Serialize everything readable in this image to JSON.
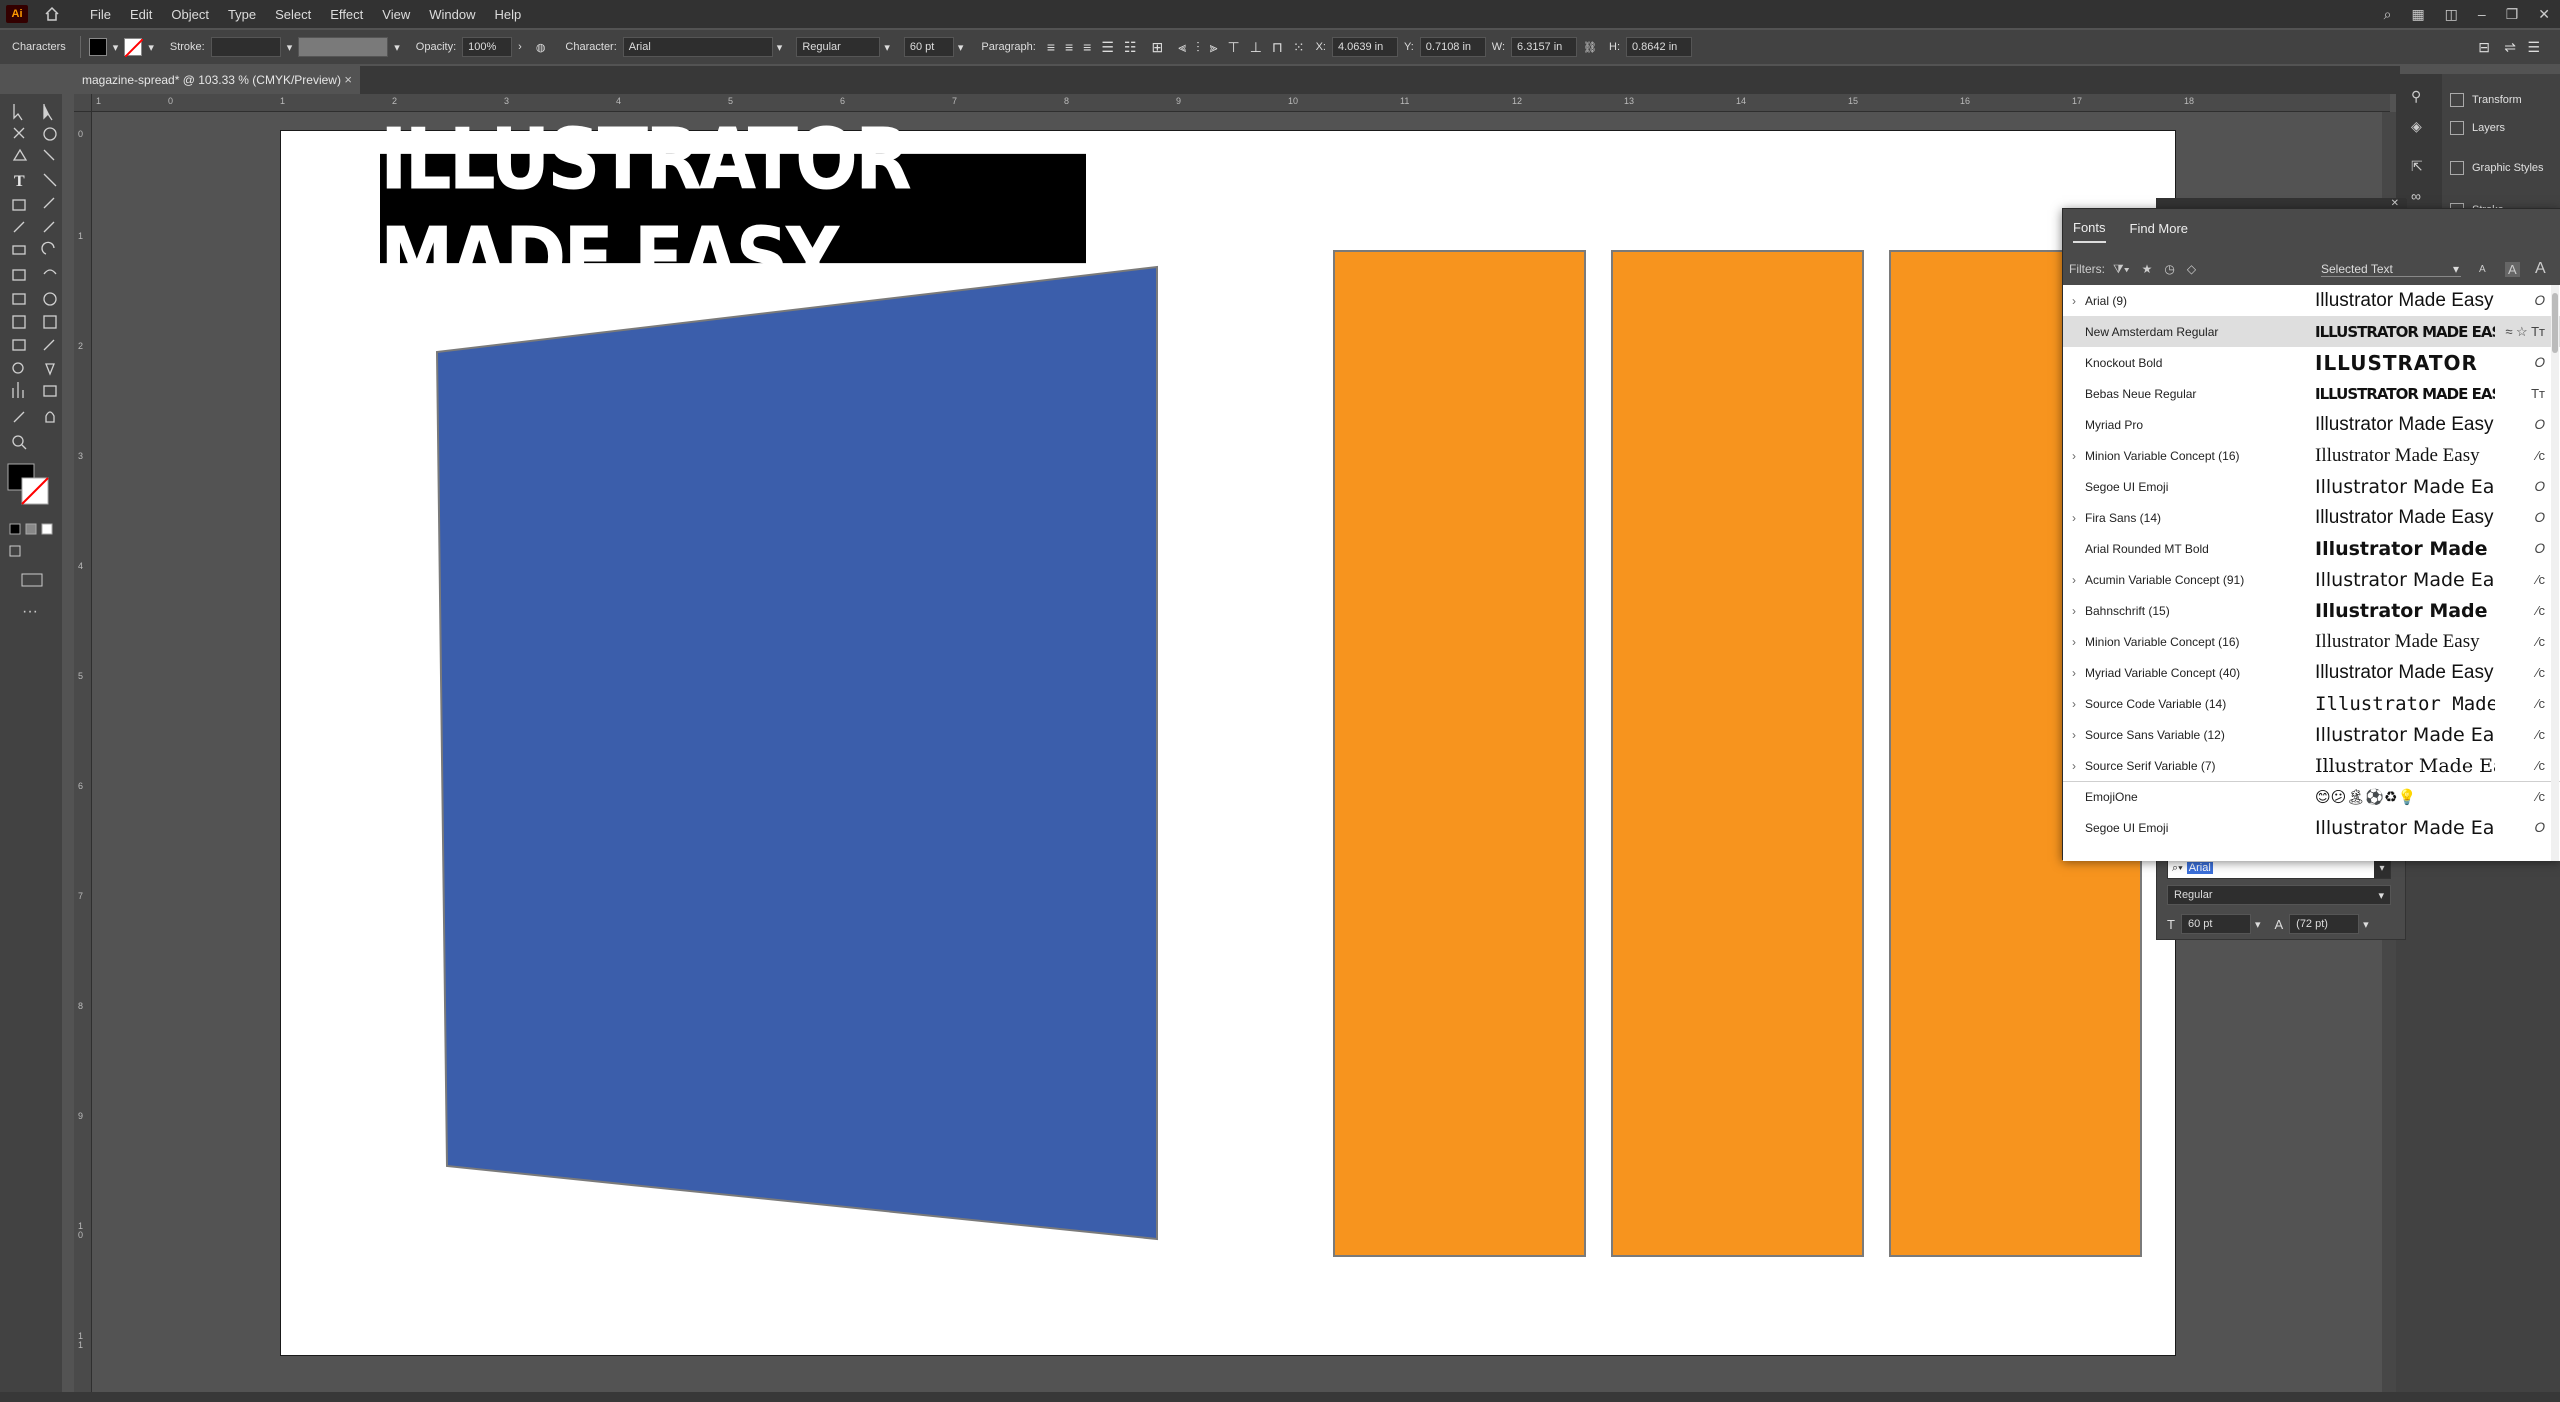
{
  "menubar": {
    "app_logo": "Ai",
    "items": [
      "File",
      "Edit",
      "Object",
      "Type",
      "Select",
      "Effect",
      "View",
      "Window",
      "Help"
    ]
  },
  "control": {
    "panel_name": "Characters",
    "stroke_label": "Stroke:",
    "opacity_label": "Opacity:",
    "opacity_value": "100%",
    "character_label": "Character:",
    "font_value": "Arial",
    "style_value": "Regular",
    "size_value": "60 pt",
    "paragraph_label": "Paragraph:",
    "x_label": "X:",
    "x_value": "4.0639 in",
    "y_label": "Y:",
    "y_value": "0.7108 in",
    "w_label": "W:",
    "w_value": "6.3157 in",
    "h_label": "H:",
    "h_value": "0.8642 in"
  },
  "document": {
    "tab_title": "magazine-spread* @ 103.33 % (CMYK/Preview)",
    "close": "×"
  },
  "ruler": {
    "h_ticks": [
      "1",
      "0",
      "1",
      "2",
      "3",
      "4",
      "5",
      "6",
      "7",
      "8",
      "9",
      "10",
      "11",
      "12",
      "13",
      "14",
      "15",
      "16",
      "17",
      "18"
    ],
    "v_ticks": [
      "0",
      "1",
      "2",
      "3",
      "4",
      "5",
      "6",
      "7",
      "8",
      "9",
      "1\n0",
      "1\n1"
    ]
  },
  "artboard": {
    "headline": "ILLUSTRATOR MADE EASY"
  },
  "colors": {
    "blue_shape": "#3b5eab",
    "orange_shape": "#f7941e"
  },
  "panels": {
    "transform": "Transform",
    "layers": "Layers",
    "graphic_styles": "Graphic Styles",
    "stroke": "Stroke"
  },
  "font_panel": {
    "tab_fonts": "Fonts",
    "tab_find_more": "Find More",
    "filters_label": "Filters:",
    "selected_text": "Selected Text",
    "fonts": [
      {
        "name": "Arial (9)",
        "preview": "Illustrator Made Easy",
        "has_children": true,
        "selected": false
      },
      {
        "name": "New Amsterdam Regular",
        "preview": "ILLUSTRATOR MADE EASY",
        "has_children": false,
        "selected": true
      },
      {
        "name": "Knockout Bold",
        "preview": "ILLUSTRATOR",
        "has_children": false,
        "selected": false
      },
      {
        "name": "Bebas Neue Regular",
        "preview": "ILLUSTRATOR MADE EASY",
        "has_children": false,
        "selected": false
      },
      {
        "name": "Myriad Pro",
        "preview": "Illustrator Made Easy",
        "has_children": false,
        "selected": false
      },
      {
        "name": "Minion Variable Concept (16)",
        "preview": "Illustrator Made Easy",
        "has_children": true,
        "selected": false
      },
      {
        "name": "Segoe UI Emoji",
        "preview": "Illustrator Made Easy",
        "has_children": false,
        "selected": false
      },
      {
        "name": "Fira Sans (14)",
        "preview": "Illustrator Made Easy",
        "has_children": true,
        "selected": false
      },
      {
        "name": "Arial Rounded MT Bold",
        "preview": "Illustrator Made Easy",
        "has_children": false,
        "selected": false
      },
      {
        "name": "Acumin Variable Concept (91)",
        "preview": "Illustrator Made Easy",
        "has_children": true,
        "selected": false
      },
      {
        "name": "Bahnschrift (15)",
        "preview": "Illustrator Made Easy",
        "has_children": true,
        "selected": false
      },
      {
        "name": "Minion Variable Concept (16)",
        "preview": "Illustrator Made Easy",
        "has_children": true,
        "selected": false
      },
      {
        "name": "Myriad Variable Concept (40)",
        "preview": "Illustrator Made Easy",
        "has_children": true,
        "selected": false
      },
      {
        "name": "Source Code Variable (14)",
        "preview": "Illustrator Made",
        "has_children": true,
        "selected": false
      },
      {
        "name": "Source Sans Variable (12)",
        "preview": "Illustrator Made Easy",
        "has_children": true,
        "selected": false
      },
      {
        "name": "Source Serif Variable (7)",
        "preview": "Illustrator Made Easy",
        "has_children": true,
        "selected": false
      },
      {
        "name": "EmojiOne",
        "preview": "😊😕🏝⚽♻💡",
        "has_children": false,
        "selected": false
      },
      {
        "name": "Segoe UI Emoji",
        "preview": "Illustrator Made Easy",
        "has_children": false,
        "selected": false
      }
    ],
    "search_value": "Arial",
    "style_value": "Regular",
    "size_value": "60 pt",
    "leading_value": "(72 pt)"
  }
}
